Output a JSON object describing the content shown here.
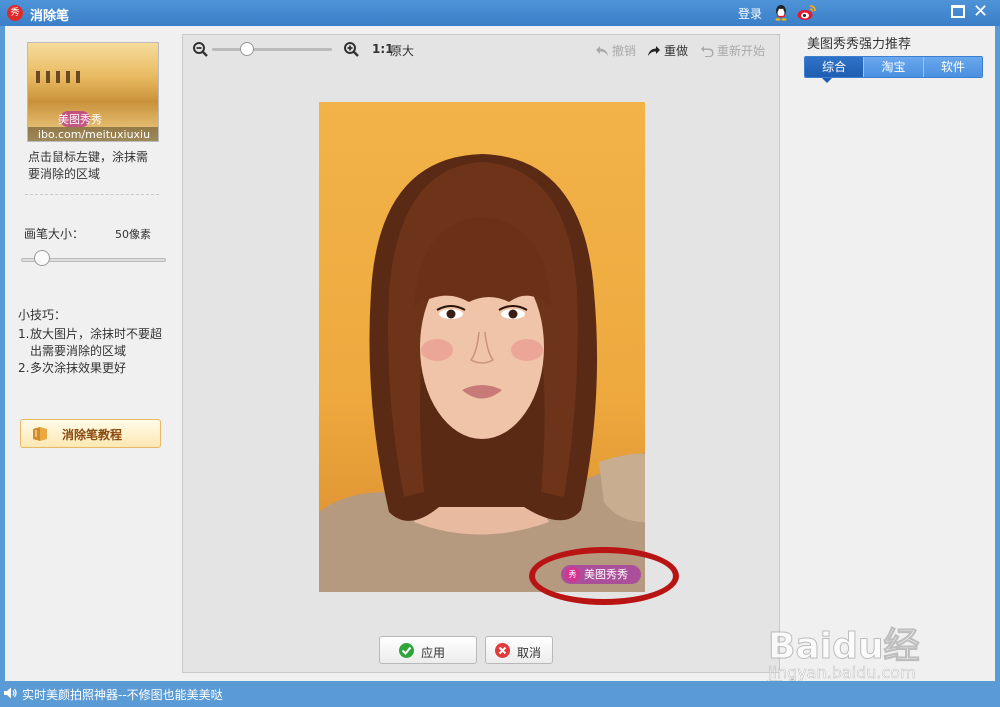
{
  "titlebar": {
    "app_logo": "秀",
    "title": "消除笔",
    "login": "登录",
    "icons": {
      "qq": "qq-icon",
      "weibo": "weibo-icon",
      "maximize": "maximize-icon",
      "close": "close-icon"
    },
    "close_glyph": "✕"
  },
  "left": {
    "thumbnail": {
      "watermark": "美图秀秀",
      "url": "ibo.com/meituxiuxiu"
    },
    "hint": "点击鼠标左键，涂抹需要消除的区域",
    "brush": {
      "label": "画笔大小：",
      "value": "50像素",
      "level": 0.1
    },
    "tips_title": "小技巧：",
    "tips": [
      {
        "num": "1.",
        "text": "放大图片，涂抹时不要超出需要消除的区域"
      },
      {
        "num": "2.",
        "text": "多次涂抹效果更好"
      }
    ],
    "tutorial_label": "消除笔教程"
  },
  "canvas": {
    "zoom_level": 0.26,
    "ratio_label": "1:1",
    "ratio_text": "原大",
    "undo": "撤销",
    "redo": "重做",
    "restart": "重新开始",
    "watermark_logo": "秀",
    "watermark_text": "美图秀秀",
    "apply": "应用",
    "cancel": "取消"
  },
  "right": {
    "title": "美图秀秀强力推荐",
    "tabs": [
      {
        "label": "综合",
        "active": true
      },
      {
        "label": "淘宝",
        "active": false
      },
      {
        "label": "软件",
        "active": false
      }
    ]
  },
  "overlay": {
    "baidu": "Baidu经验",
    "baidu_url": "jingyan.baidu.com"
  },
  "statusbar": {
    "text": "实时美颜拍照神器--不修图也能美美哒"
  },
  "colors": {
    "titlebar": "#3a7fc8",
    "accent": "#1f5db0",
    "ring": "#b81414"
  }
}
